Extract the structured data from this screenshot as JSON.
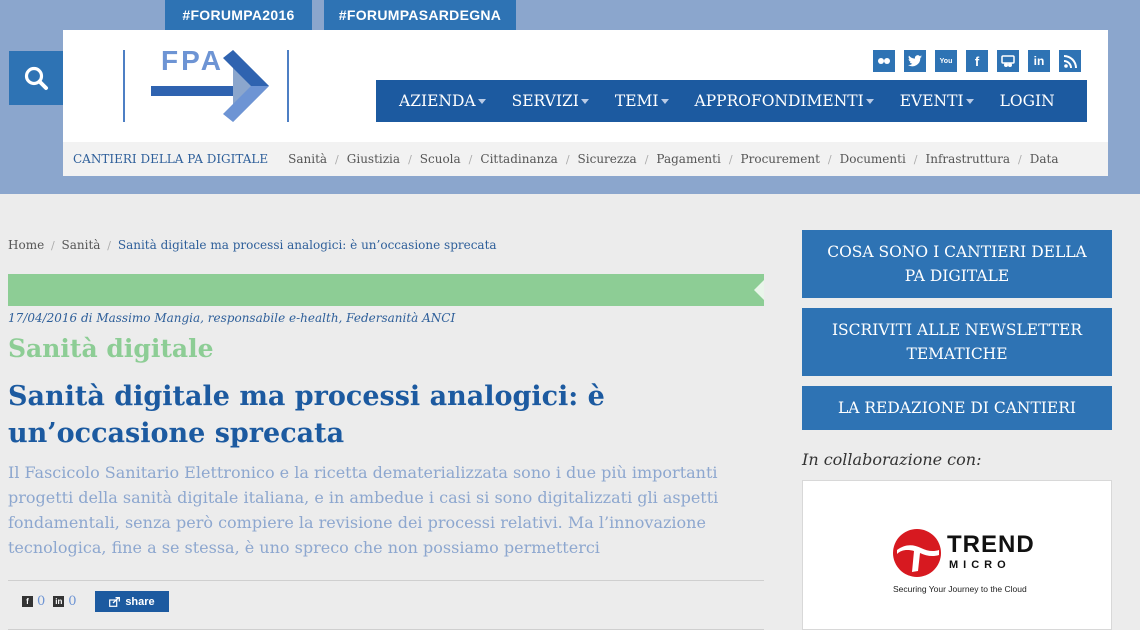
{
  "top_tags": [
    "#FORUMPA2016",
    "#FORUMPASARDEGNA"
  ],
  "logo": {
    "text": "FPA"
  },
  "social": [
    {
      "icon": "flickr-icon",
      "label": "flickr"
    },
    {
      "icon": "twitter-icon",
      "label": "t"
    },
    {
      "icon": "youtube-icon",
      "label": "You"
    },
    {
      "icon": "facebook-icon",
      "label": "f"
    },
    {
      "icon": "slideshare-icon",
      "label": "s"
    },
    {
      "icon": "linkedin-icon",
      "label": "in"
    },
    {
      "icon": "rss-icon",
      "label": "rss"
    }
  ],
  "main_nav": [
    {
      "label": "AZIENDA",
      "dropdown": true
    },
    {
      "label": "SERVIZI",
      "dropdown": true
    },
    {
      "label": "TEMI",
      "dropdown": true
    },
    {
      "label": "APPROFONDIMENTI",
      "dropdown": true
    },
    {
      "label": "EVENTI",
      "dropdown": true
    },
    {
      "label": "LOGIN",
      "dropdown": false
    }
  ],
  "sub_nav": {
    "title": "CANTIERI DELLA PA DIGITALE",
    "items": [
      "Sanità",
      "Giustizia",
      "Scuola",
      "Cittadinanza",
      "Sicurezza",
      "Pagamenti",
      "Procurement",
      "Documenti",
      "Infrastruttura",
      "Data"
    ]
  },
  "breadcrumb": {
    "home": "Home",
    "section": "Sanità",
    "current": "Sanità digitale ma processi analogici: è un’occasione sprecata"
  },
  "article": {
    "byline": "17/04/2016 di Massimo Mangia, responsabile e-health, Federsanità ANCI",
    "category": "Sanità digitale",
    "headline": "Sanità digitale ma processi analogici: è un’occasione sprecata",
    "abstract": "Il Fascicolo Sanitario Elettronico e la ricetta dematerializzata sono i due più importanti progetti della sanità digitale italiana, e in ambedue i casi si sono digitalizzati gli aspetti fondamentali, senza però compiere la revisione dei processi relativi. Ma l’innovazione tecnologica, fine a se stessa, è uno spreco che non possiamo permetterci",
    "facebook_count": "0",
    "linkedin_count": "0",
    "share_label": "share"
  },
  "sidebar": {
    "buttons": [
      "COSA SONO I CANTIERI DELLA PA DIGITALE",
      "ISCRIVITI ALLE NEWSLETTER TEMATICHE",
      "LA REDAZIONE DI CANTIERI"
    ],
    "collab_label": "In collaborazione con:",
    "sponsor": {
      "brand_line1": "TREND",
      "brand_line2": "MICRO",
      "tagline": "Securing Your Journey to the Cloud"
    }
  },
  "colors": {
    "primary_blue": "#2e73b4",
    "nav_blue": "#1c5aa0",
    "category_green": "#8dcd95",
    "top_band": "#8ba6cd",
    "trend_red": "#d71920"
  }
}
